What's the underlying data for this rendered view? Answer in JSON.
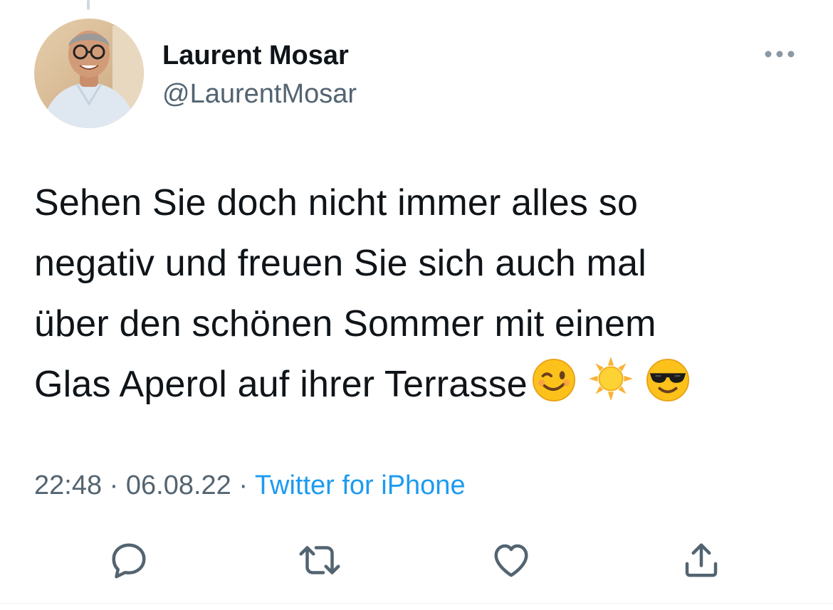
{
  "tweet": {
    "author": {
      "display_name": "Laurent Mosar",
      "handle": "@LaurentMosar"
    },
    "text_lines": [
      "Sehen Sie doch nicht immer alles so",
      "negativ und freuen Sie sich auch mal",
      "über den schönen Sommer mit einem",
      "Glas Aperol auf ihrer Terrasse"
    ],
    "emojis": [
      "winking-face",
      "sun",
      "smiling-face-with-sunglasses"
    ],
    "meta": {
      "time": "22:48",
      "separator": "·",
      "date": "06.08.22",
      "source": "Twitter for iPhone"
    },
    "actions": [
      "reply-icon",
      "retweet-icon",
      "like-icon",
      "share-icon"
    ],
    "colors": {
      "text": "#0f1419",
      "secondary": "#536471",
      "link": "#1d9bf0"
    }
  }
}
